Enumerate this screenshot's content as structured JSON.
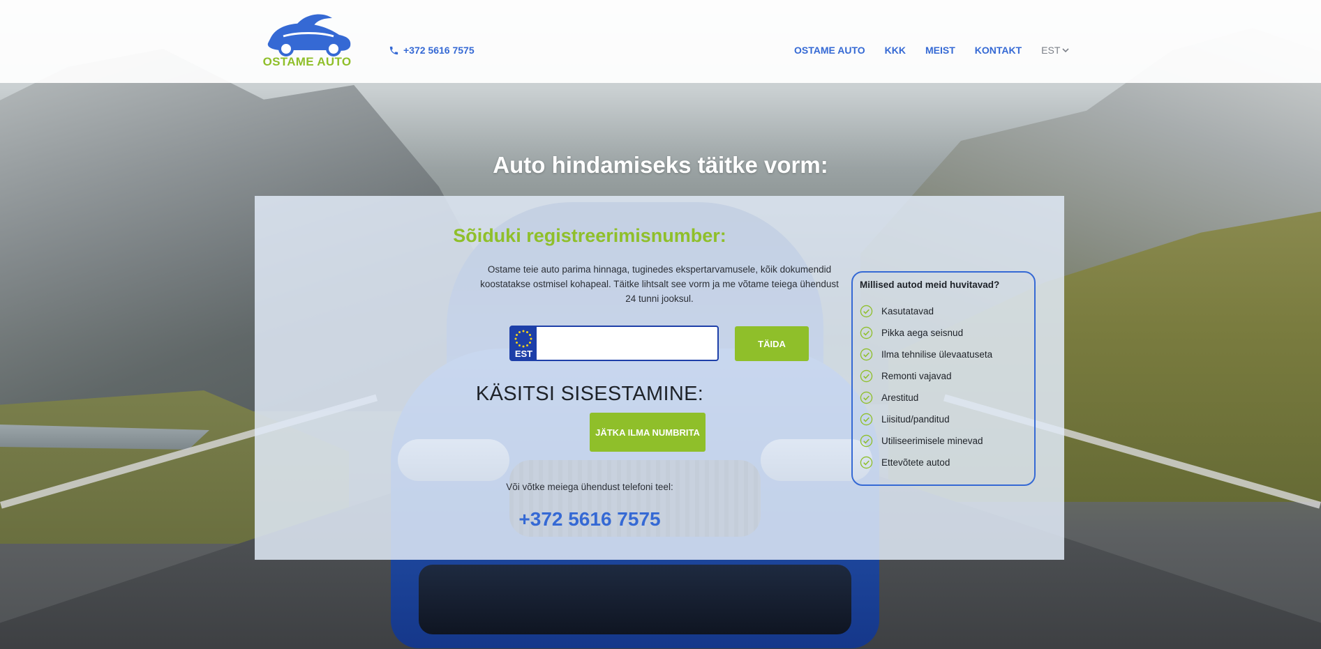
{
  "header": {
    "logo_text": "OSTAME AUTO",
    "phone": "+372 5616 7575",
    "nav": [
      "OSTAME AUTO",
      "KKK",
      "MEIST",
      "KONTAKT"
    ],
    "language": "EST"
  },
  "main": {
    "title": "Auto hindamiseks täitke vorm:",
    "heading": "Sõiduki registreerimisnumber:",
    "description": "Ostame teie auto parima hinnaga, tuginedes ekspertarvamusele, kõik dokumendid koostatakse ostmisel kohapeal. Täitke lihtsalt see vorm ja me võtame teiega ühendust 24 tunni jooksul.",
    "plate": {
      "country_code": "EST",
      "value": "",
      "placeholder": ""
    },
    "fill_button": "TÄIDA",
    "manual_title": "KÄSITSI SISESTAMINE:",
    "manual_button": "JÄTKA ILMA NUMBRITA",
    "or_call": "Või võtke meiega ühendust telefoni teel:",
    "phone": "+372 5616 7575"
  },
  "sidebar": {
    "title": "Millised autod meid huvitavad?",
    "items": [
      "Kasutatavad",
      "Pikka aega seisnud",
      "Ilma tehnilise ülevaatuseta",
      "Remonti vajavad",
      "Arestitud",
      "Liisitud/panditud",
      "Utiliseerimisele minevad",
      "Ettevõtete autod"
    ]
  },
  "colors": {
    "accent_blue": "#3569d4",
    "accent_green": "#8fbf2a",
    "plate_blue": "#1d3fa8"
  },
  "icons": {
    "phone": "phone-icon",
    "language_dropdown": "chevron-down-icon",
    "checklist": "check-circle-icon",
    "eu_flag": "eu-stars-icon"
  }
}
